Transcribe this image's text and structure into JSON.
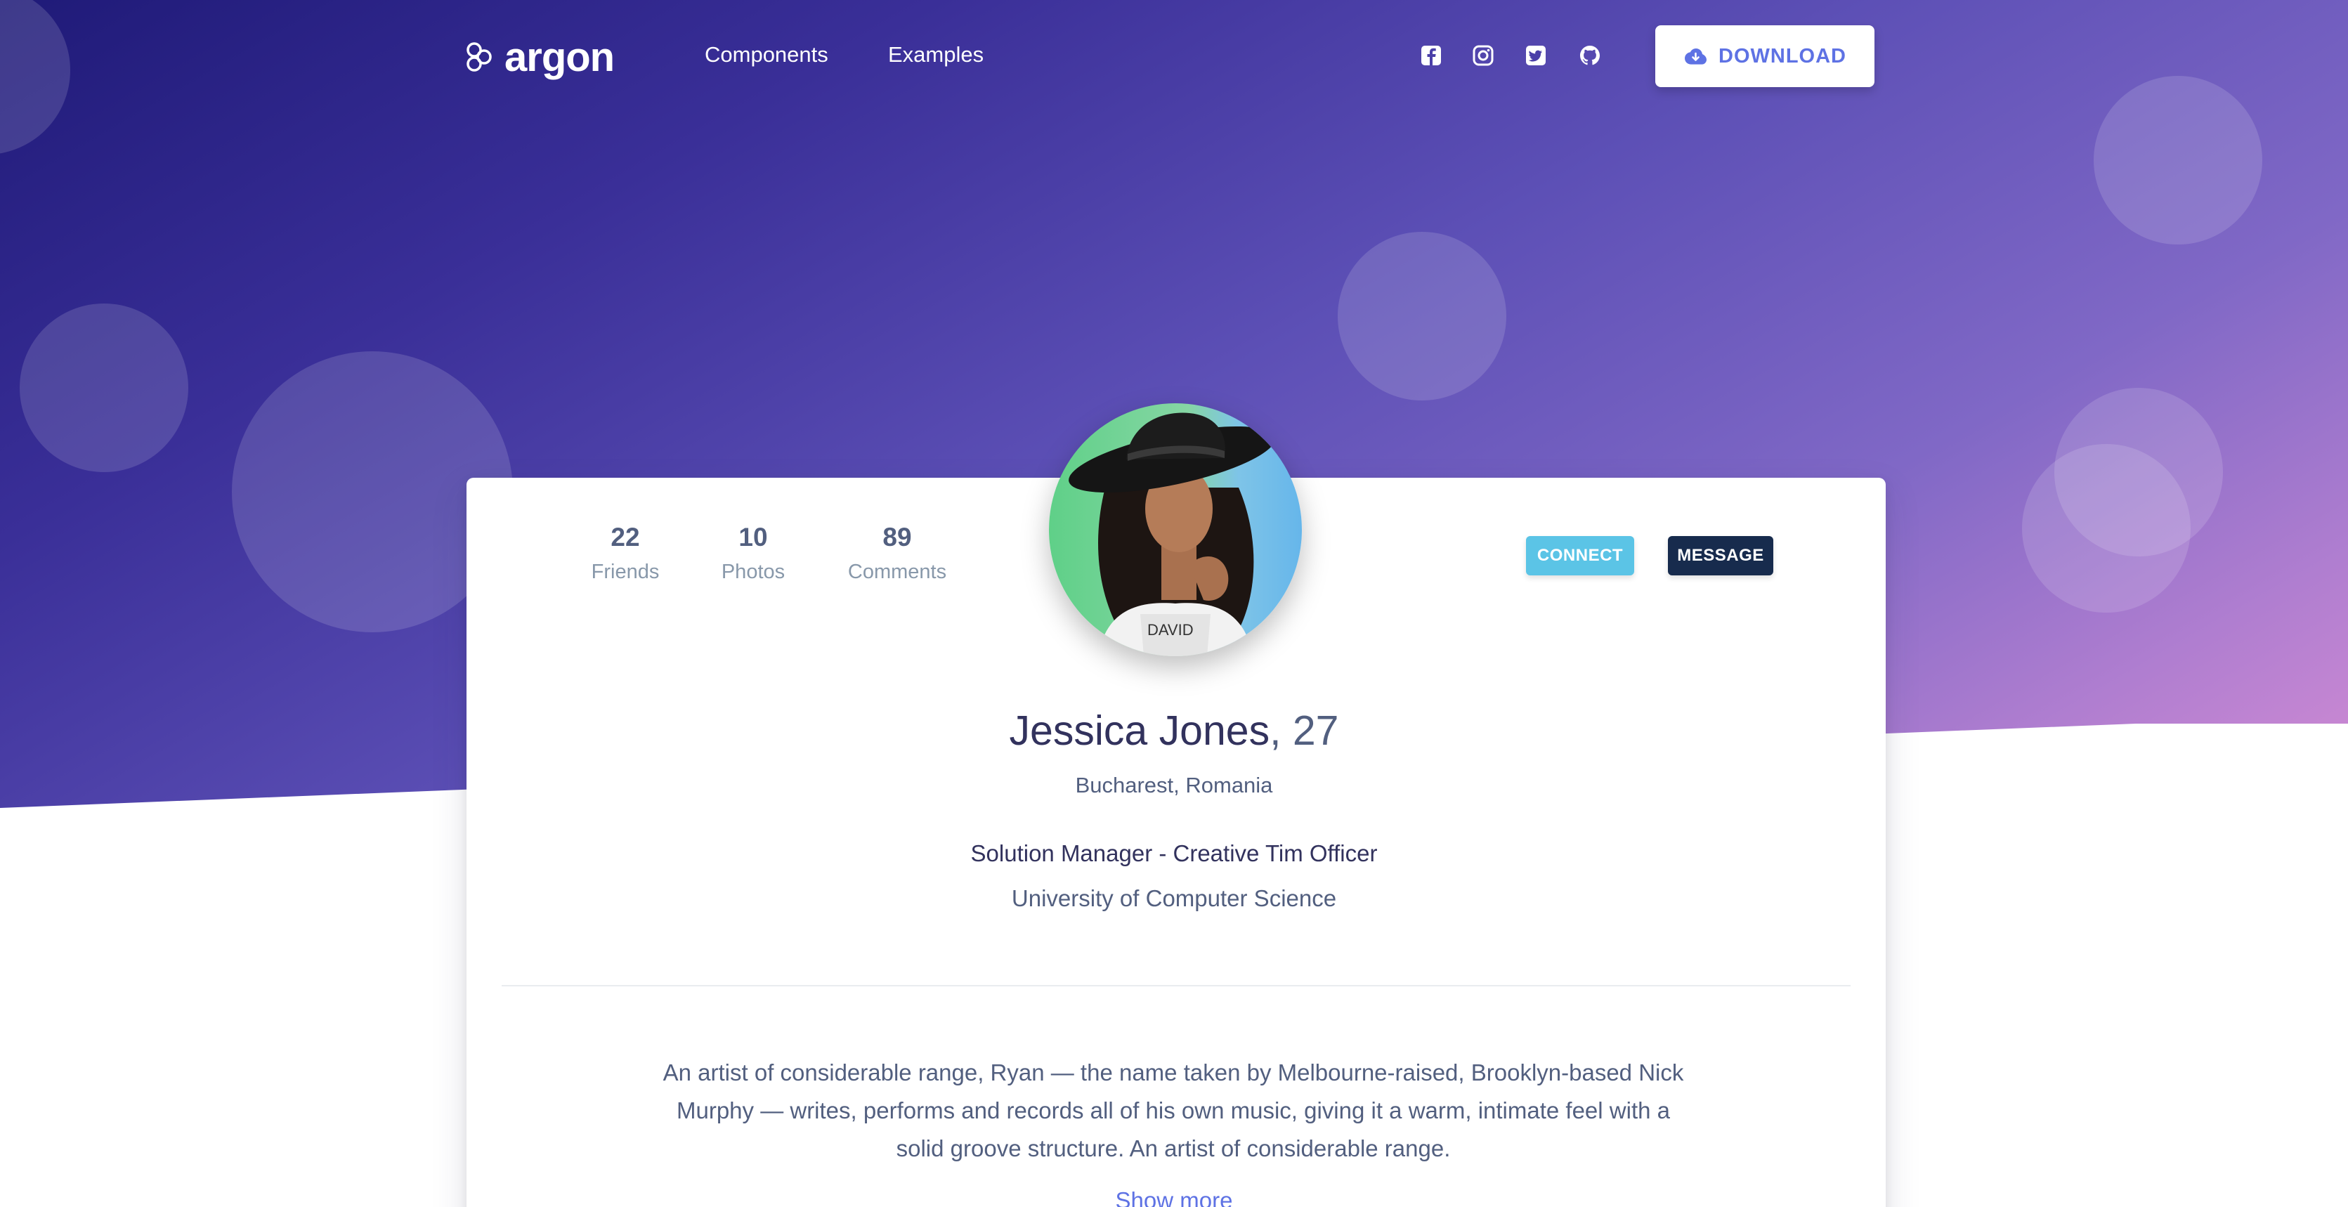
{
  "navbar": {
    "brand": "argon",
    "links": [
      "Components",
      "Examples"
    ],
    "social_icons": [
      "facebook-icon",
      "instagram-icon",
      "twitter-icon",
      "github-icon"
    ],
    "download_label": "DOWNLOAD"
  },
  "profile": {
    "stats": [
      {
        "value": "22",
        "label": "Friends"
      },
      {
        "value": "10",
        "label": "Photos"
      },
      {
        "value": "89",
        "label": "Comments"
      }
    ],
    "connect_label": "CONNECT",
    "message_label": "MESSAGE",
    "name": "Jessica Jones",
    "age": ", 27",
    "location": "Bucharest, Romania",
    "job": "Solution Manager - Creative Tim Officer",
    "education": "University of Computer Science",
    "bio": "An artist of considerable range, Ryan — the name taken by Melbourne-raised, Brooklyn-based Nick Murphy — writes, performs and records all of his own music, giving it a warm, intimate feel with a solid groove structure. An artist of considerable range.",
    "show_more": "Show more"
  },
  "colors": {
    "primary": "#5e72e4",
    "info": "#5bc4e6",
    "dark": "#172b4d",
    "heading": "#32325d"
  }
}
